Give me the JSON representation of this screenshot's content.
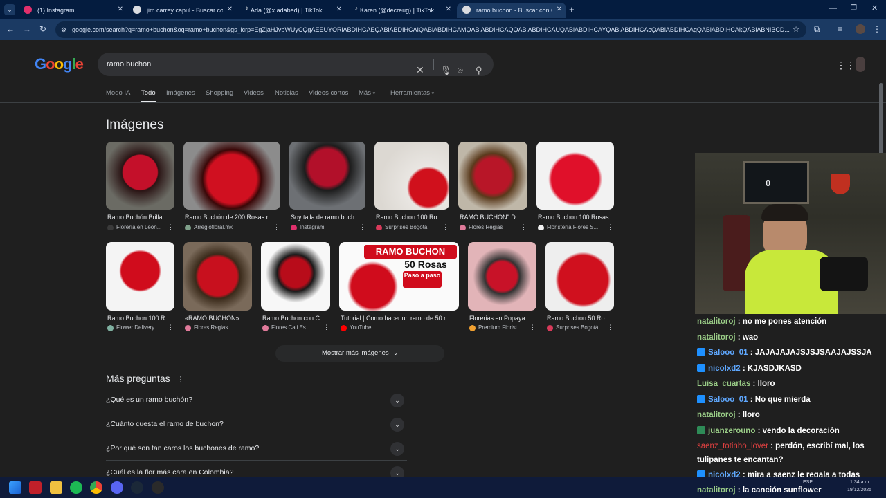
{
  "tabs": [
    {
      "title": "(1) Instagram",
      "color": "#e1306c"
    },
    {
      "title": "jim carrey capul - Buscar con Go",
      "color": "#9aa0a6"
    },
    {
      "title": "Ada (@x.adabed) | TikTok",
      "color": "#000000"
    },
    {
      "title": "Karen (@decreug) | TikTok",
      "color": "#000000"
    },
    {
      "title": "ramo buchon - Buscar con Goo",
      "color": "#9aa0a6"
    }
  ],
  "url": "google.com/search?q=ramo+buchon&oq=ramo+buchon&gs_lcrp=EgZjaHJvbWUyCQgAEEUYORiABDIHCAEQABiABDIHCAIQABiABDIHCAMQABiABDIHCAQQABiABDIHCAUQABiABDIHCAYQABiABDIHCAcQABiABDIHCAgQABiABDIHCAkQABiABNIBCD...",
  "logo": "Google",
  "search": {
    "query": "ramo buchon"
  },
  "nav": [
    "Modo IA",
    "Todo",
    "Imágenes",
    "Shopping",
    "Videos",
    "Noticias",
    "Videos cortos",
    "Más",
    "Herramientas"
  ],
  "images_title": "Imágenes",
  "images_row1": [
    {
      "caption": "Ramo Buchón Brilla...",
      "source": "Florería en León..."
    },
    {
      "caption": "Ramo Buchón de 200 Rosas r...",
      "source": "Arreglofloral.mx"
    },
    {
      "caption": "Soy talla de ramo buch...",
      "source": "Instagram"
    },
    {
      "caption": "Ramo Buchon 100 Ro...",
      "source": "Surprises Bogotá"
    },
    {
      "caption": "RAMO BUCHON\" D...",
      "source": "Flores Regias"
    },
    {
      "caption": "Ramo Buchon 100 Rosas",
      "source": "Floristería Flores S..."
    }
  ],
  "images_row2": [
    {
      "caption": "Ramo Buchon 100 R...",
      "source": "Flower Delivery..."
    },
    {
      "caption": "«RAMO BUCHON» ...",
      "source": "Flores Regias"
    },
    {
      "caption": "Ramo Buchon con C...",
      "source": "Flores Cali Es ..."
    },
    {
      "caption": "Tutorial | Como hacer un ramo de 50 r...",
      "source": "YouTube"
    },
    {
      "caption": "Florerias en Popaya...",
      "source": "Premium Florist"
    },
    {
      "caption": "Ramo Buchon 50 Ro...",
      "source": "Surprises Bogotá"
    }
  ],
  "thumb_text": {
    "t1": "RAMO BUCHON",
    "t2": "50 Rosas",
    "t3": "Paso a paso"
  },
  "more_images": "Mostrar más imágenes",
  "questions_title": "Más preguntas",
  "questions": [
    "¿Qué es un ramo buchón?",
    "¿Cuánto cuesta el ramo de buchon?",
    "¿Por qué son tan caros los buchones de ramo?",
    "¿Cuál es la flor más cara en Colombia?"
  ],
  "chat": [
    {
      "user": "natalitoroj",
      "msg": "no me pones atención",
      "color": "#9acd87",
      "badge": ""
    },
    {
      "user": "natalitoroj",
      "msg": "wao",
      "color": "#9acd87",
      "badge": ""
    },
    {
      "user": "Salooo_01",
      "msg": "JAJAJAJAJSJSJSAAJAJSSJA",
      "color": "#5fa8ff",
      "badge": "#1e90ff"
    },
    {
      "user": "nicolxd2",
      "msg": "KJASDJKASD",
      "color": "#5fa8ff",
      "badge": "#1e90ff"
    },
    {
      "user": "Luisa_cuartas",
      "msg": "lloro",
      "color": "#9acd87",
      "badge": ""
    },
    {
      "user": "Salooo_01",
      "msg": "No que mierda",
      "color": "#5fa8ff",
      "badge": "#1e90ff"
    },
    {
      "user": "natalitoroj",
      "msg": "lloro",
      "color": "#9acd87",
      "badge": ""
    },
    {
      "user": "juanzerouno",
      "msg": "vendo la decoración",
      "color": "#9acd87",
      "badge": "#2e8b57"
    },
    {
      "user": "saenz_totinho_lover",
      "msg": "perdón, escribí mal, los tulipanes te encantan?",
      "color": "#e04040",
      "badge": ""
    },
    {
      "user": "nicolxd2",
      "msg": "mira a saenz le regala a todas",
      "color": "#5fa8ff",
      "badge": "#1e90ff"
    },
    {
      "user": "natalitoroj",
      "msg": "la canción sunflower",
      "color": "#9acd87",
      "badge": ""
    }
  ],
  "webcam_digit": "0",
  "taskbar": {
    "lang": "ESP",
    "time": "1:34 a.m.",
    "date": "19/12/2025"
  }
}
